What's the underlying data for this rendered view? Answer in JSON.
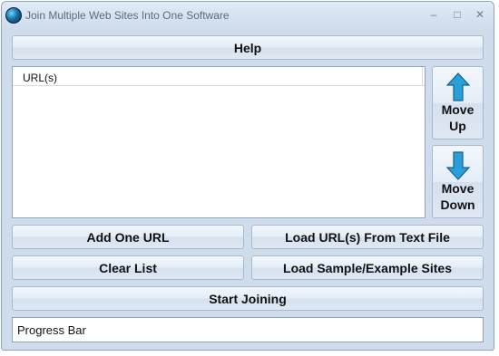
{
  "window": {
    "title": "Join Multiple Web Sites Into One Software",
    "minimize_glyph": "–",
    "maximize_glyph": "□",
    "close_glyph": "✕"
  },
  "buttons": {
    "help": "Help",
    "move_up_line1": "Move",
    "move_up_line2": "Up",
    "move_down_line1": "Move",
    "move_down_line2": "Down",
    "add_one_url": "Add One URL",
    "load_from_text_file": "Load URL(s) From Text File",
    "clear_list": "Clear List",
    "load_sample_sites": "Load Sample/Example Sites",
    "start_joining": "Start Joining"
  },
  "url_list": {
    "column_header": "URL(s)",
    "rows": []
  },
  "progress": {
    "label": "Progress Bar"
  },
  "colors": {
    "window_bg": "#cfdcec",
    "arrow_fill": "#2a9ed8"
  },
  "icons": {
    "app": "globe-icon",
    "move_up": "arrow-up-icon",
    "move_down": "arrow-down-icon"
  }
}
